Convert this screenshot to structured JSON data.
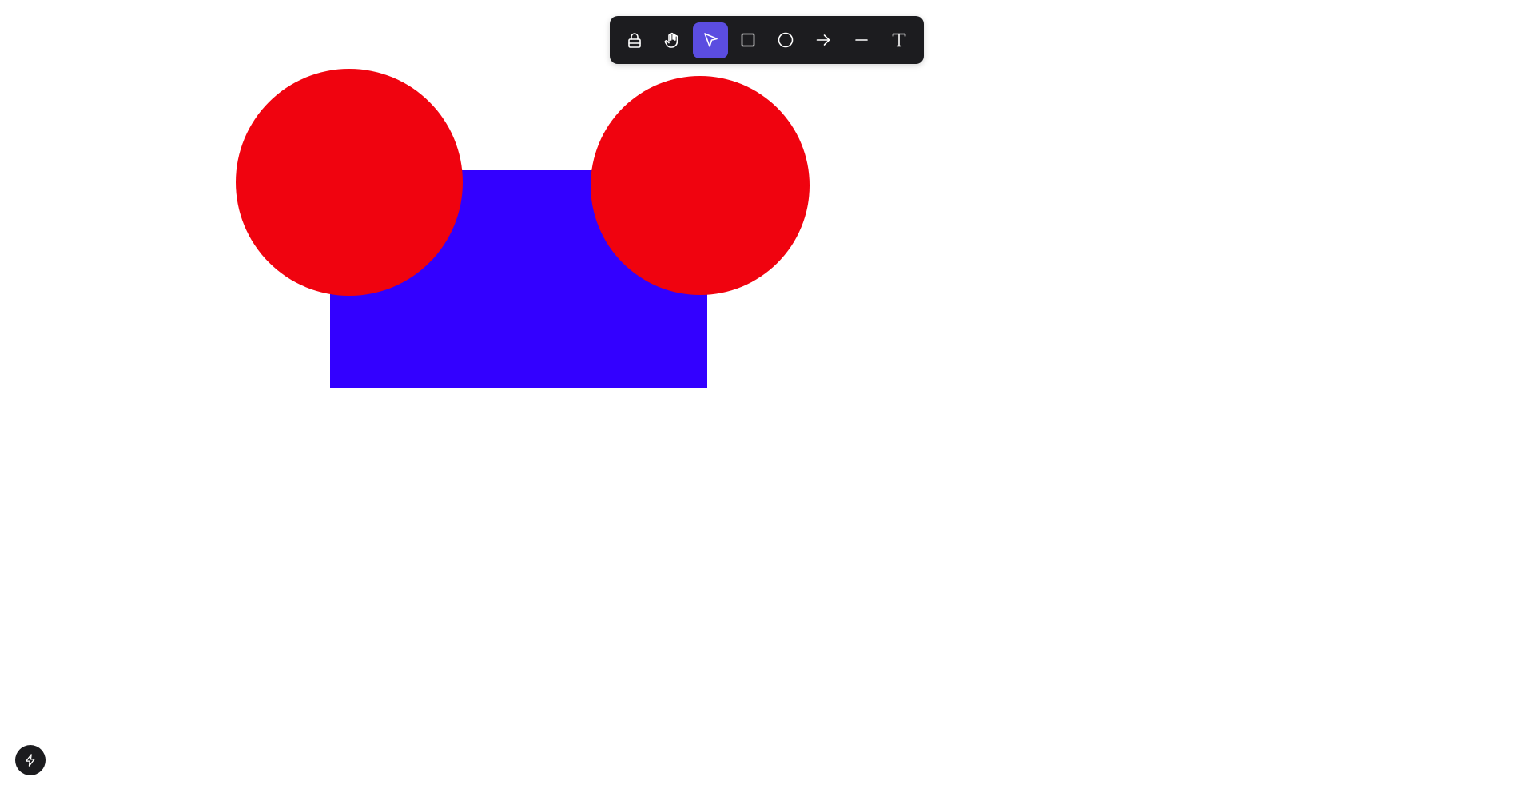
{
  "canvas": {
    "background": "#ffffff",
    "shapes": [
      {
        "kind": "rectangle",
        "fill": "#3300ff"
      },
      {
        "kind": "ellipse",
        "fill": "#f0030f"
      },
      {
        "kind": "ellipse",
        "fill": "#f0030f"
      }
    ]
  },
  "toolbar": {
    "background": "#1c1c1f",
    "active_color": "#5b4de0",
    "tools": [
      {
        "name": "lock",
        "icon": "lock-icon"
      },
      {
        "name": "hand",
        "icon": "hand-icon"
      },
      {
        "name": "select",
        "icon": "pointer-icon",
        "active": true
      },
      {
        "name": "rectangle",
        "icon": "square-icon"
      },
      {
        "name": "ellipse",
        "icon": "circle-icon"
      },
      {
        "name": "arrow",
        "icon": "arrow-right-icon"
      },
      {
        "name": "line",
        "icon": "line-icon"
      },
      {
        "name": "text",
        "icon": "text-icon"
      }
    ]
  },
  "quick_action": {
    "icon": "bolt-icon"
  }
}
